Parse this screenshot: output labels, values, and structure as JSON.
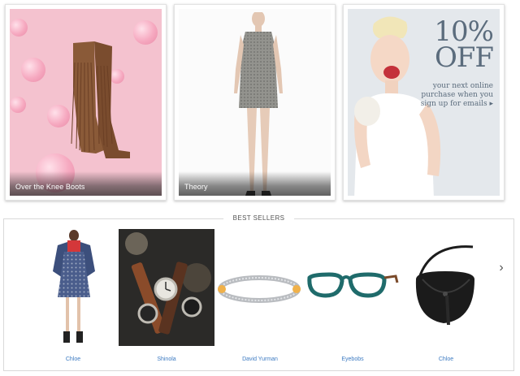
{
  "tiles": [
    {
      "caption": "Over the Knee Boots"
    },
    {
      "caption": "Theory"
    },
    {
      "promo": {
        "headline_line1": "10%",
        "headline_line2": "OFF",
        "subtext": "your next online purchase when you sign up for emails",
        "arrow": "▸"
      }
    }
  ],
  "best_sellers": {
    "title": "BEST SELLERS",
    "next_icon": "chevron-right-icon",
    "next_glyph": "›",
    "products": [
      {
        "label": "Chloe"
      },
      {
        "label": "Shinola"
      },
      {
        "label": "David Yurman"
      },
      {
        "label": "Eyebobs"
      },
      {
        "label": "Chloe"
      }
    ]
  },
  "colors": {
    "link_blue": "#3d7bc2",
    "promo_slate": "#5b6c7d",
    "pink_bg": "#f4c2cf"
  }
}
